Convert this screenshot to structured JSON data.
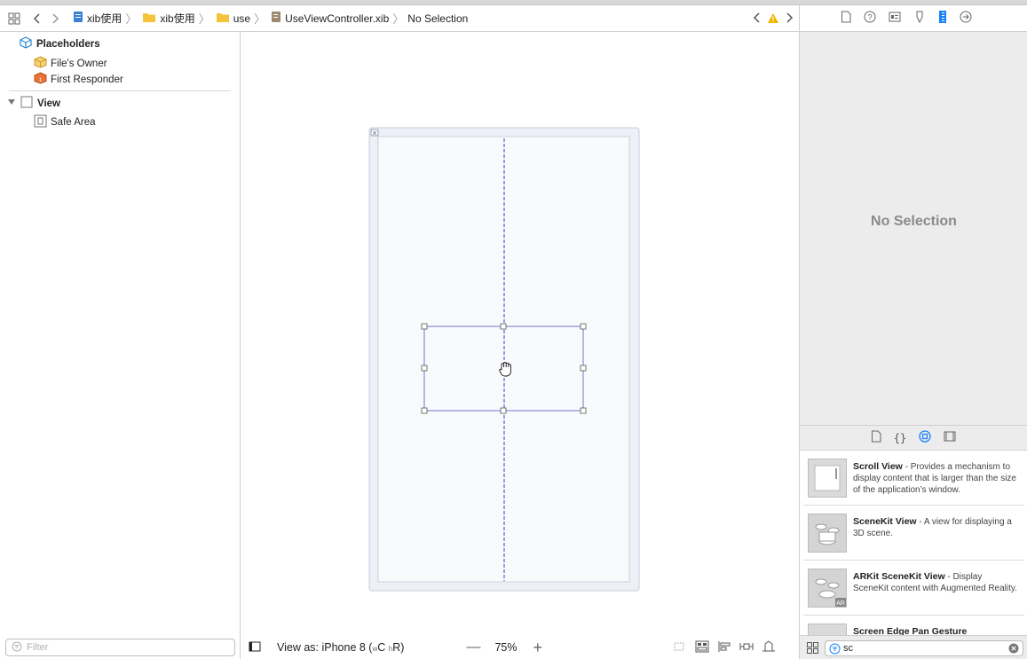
{
  "jumpbar": {
    "crumbs": [
      "xib使用",
      "xib使用",
      "use",
      "UseViewController.xib",
      "No Selection"
    ]
  },
  "outline": {
    "placeholders_label": "Placeholders",
    "files_owner": "File's Owner",
    "first_responder": "First Responder",
    "view_label": "View",
    "safe_area": "Safe Area",
    "filter_placeholder": "Filter"
  },
  "canvas": {
    "view_as": "View as: iPhone 8 (",
    "size_class_w": "w",
    "size_class_c": "C",
    "size_class_h": "h",
    "size_class_r": "R)",
    "zoom": "75%"
  },
  "inspector": {
    "no_selection": "No Selection"
  },
  "library": {
    "items": [
      {
        "name": "Scroll View",
        "desc": " - Provides a mechanism to display content that is larger than the size of the application’s window."
      },
      {
        "name": "SceneKit View",
        "desc": " - A view for displaying a 3D scene."
      },
      {
        "name": "ARKit SceneKit View",
        "desc": " - Display SceneKit content with Augmented Reality."
      },
      {
        "name": "Screen Edge Pan Gesture",
        "desc": ""
      }
    ],
    "search_value": "sc"
  },
  "colors": {
    "accent": "#1a82fb",
    "guide": "#3a3ad0",
    "selection": "#8a8ad8"
  }
}
